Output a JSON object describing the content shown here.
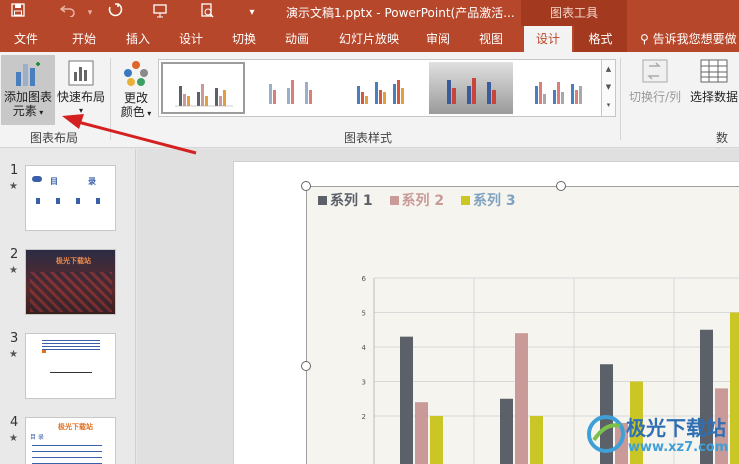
{
  "titlebar": {
    "title": "演示文稿1.pptx - PowerPoint(产品激活...",
    "context_tools": "图表工具",
    "quick_access": [
      "save-icon",
      "undo-icon",
      "redo-icon",
      "present-icon",
      "preview-icon",
      "customize-icon"
    ]
  },
  "tabs": [
    {
      "label": "文件"
    },
    {
      "label": "开始"
    },
    {
      "label": "插入"
    },
    {
      "label": "设计"
    },
    {
      "label": "切换"
    },
    {
      "label": "动画"
    },
    {
      "label": "幻灯片放映"
    },
    {
      "label": "审阅"
    },
    {
      "label": "视图"
    },
    {
      "label": "设计"
    },
    {
      "label": "格式"
    }
  ],
  "tellme": "告诉我您想要做",
  "ribbon": {
    "add_element_line1": "添加图表",
    "add_element_line2": "元素",
    "quick_layout": "快速布局",
    "change_colors_line1": "更改",
    "change_colors_line2": "颜色",
    "group_chart_layout": "图表布局",
    "group_chart_styles": "图表样式",
    "switch_row_col": "切换行/列",
    "select_data": "选择数据",
    "group_data": "数据"
  },
  "slides": [
    {
      "number": "1",
      "star": "★",
      "title_left": "目",
      "title_right": "录"
    },
    {
      "number": "2",
      "star": "★",
      "title": "极光下载站"
    },
    {
      "number": "3",
      "star": "★"
    },
    {
      "number": "4",
      "star": "★",
      "title": "极光下载站",
      "sub": "目 录"
    }
  ],
  "chart_data": {
    "type": "bar",
    "categories": [
      "",
      "",
      "",
      ""
    ],
    "series": [
      {
        "name": "系列 1",
        "values": [
          4.3,
          2.5,
          3.5,
          4.5
        ],
        "color": "#5b6069"
      },
      {
        "name": "系列 2",
        "values": [
          2.4,
          4.4,
          1.8,
          2.8
        ],
        "color": "#c99a98"
      },
      {
        "name": "系列 3",
        "values": [
          2.0,
          2.0,
          3.0,
          5.0
        ],
        "color": "#c9c625"
      }
    ],
    "yticks": [
      "2",
      "3",
      "4",
      "5",
      "6"
    ],
    "ylim": [
      0,
      6
    ],
    "grid": true,
    "legend": "top-left"
  },
  "watermark": {
    "text": "极光下载站",
    "url": "www.xz7.com"
  },
  "colors": {
    "accent": "#b7472a",
    "arrow": "#d42020"
  }
}
